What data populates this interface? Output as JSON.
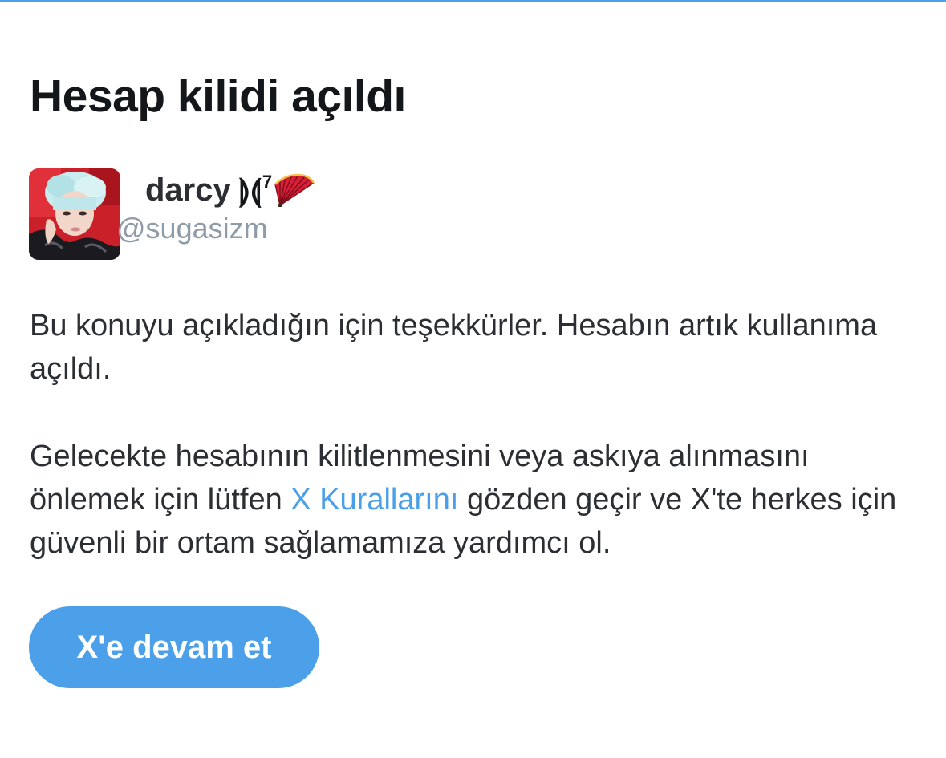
{
  "colors": {
    "accent": "#4ca0ea",
    "link": "#4a9fe8",
    "text": "#14171a",
    "muted": "#8f9ba6"
  },
  "page": {
    "title": "Hesap kilidi açıldı"
  },
  "account": {
    "display_name": "darcy",
    "name_symbol": "⟭⟬",
    "name_superscript": "7",
    "name_emoji_icon": "folding-fan-icon",
    "handle": "@sugasizm"
  },
  "message": {
    "paragraph1": "Bu konuyu açıkladığın için teşekkürler. Hesabın artık kullanıma açıldı.",
    "paragraph2_before": "Gelecekte hesabının kilitlenmesini veya askıya alınmasını önlemek için lütfen ",
    "paragraph2_link": "X Kurallarını",
    "paragraph2_after": " gözden geçir ve X'te herkes için güvenli bir ortam sağlamamıza yardımcı ol."
  },
  "actions": {
    "continue_label": "X'e devam et"
  }
}
